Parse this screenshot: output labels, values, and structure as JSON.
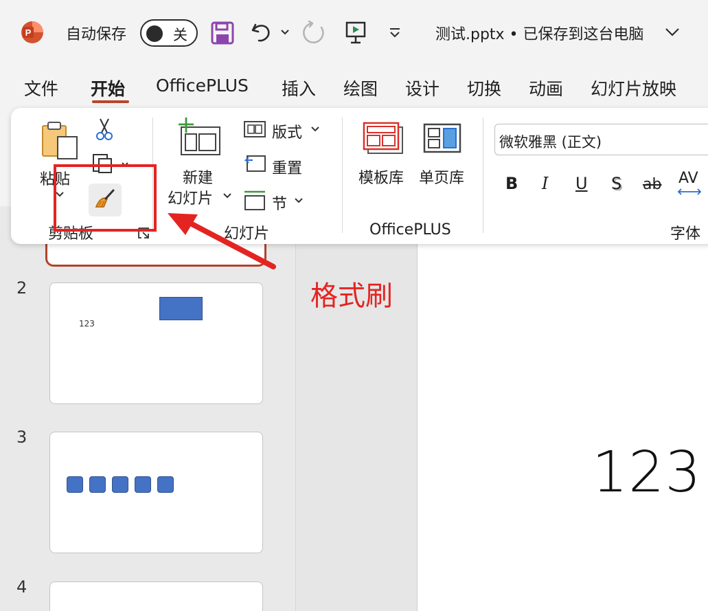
{
  "titlebar": {
    "autosave_label": "自动保存",
    "autosave_state": "关",
    "doc_title": "测试.pptx • 已保存到这台电脑",
    "icons": [
      "powerpoint-logo-icon",
      "save-icon",
      "undo-icon",
      "redo-icon",
      "slideshow-icon",
      "customize-toolbar-icon",
      "chevron-down-icon"
    ]
  },
  "tabs": [
    "文件",
    "开始",
    "OfficePLUS",
    "插入",
    "绘图",
    "设计",
    "切换",
    "动画",
    "幻灯片放映"
  ],
  "active_tab": "开始",
  "ribbon": {
    "clipboard": {
      "paste_label": "粘贴",
      "group_label": "剪贴板",
      "icons": [
        "paste-icon",
        "cut-icon",
        "copy-icon",
        "format-painter-icon",
        "dialog-launcher-icon"
      ]
    },
    "slides": {
      "new_slide_line1": "新建",
      "new_slide_line2": "幻灯片",
      "layout_label": "版式",
      "reset_label": "重置",
      "section_label": "节",
      "group_label": "幻灯片"
    },
    "officeplus": {
      "template_label": "模板库",
      "single_page_label": "单页库",
      "group_label": "OfficePLUS"
    },
    "font": {
      "font_name": "微软雅黑 (正文)",
      "group_label": "字体",
      "bold": "B",
      "italic": "I",
      "underline": "U",
      "shadow": "S",
      "strikethrough": "ab",
      "spacing": "AV"
    }
  },
  "slides_pane": {
    "slides": [
      {
        "number": "2",
        "text": "123"
      },
      {
        "number": "3"
      },
      {
        "number": "4"
      }
    ]
  },
  "canvas": {
    "text": "123"
  },
  "annotation": {
    "label": "格式刷",
    "color": "#e32421"
  }
}
